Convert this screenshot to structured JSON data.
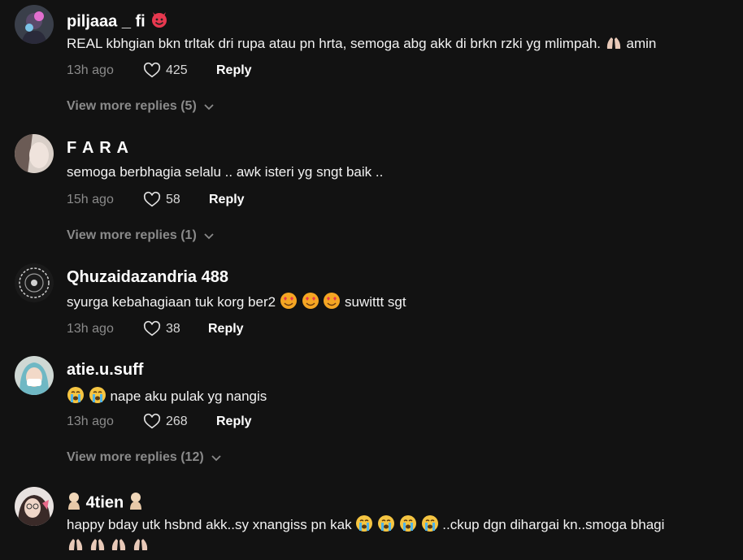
{
  "comments": [
    {
      "username": "piljaaa _ fi",
      "text": "REAL kbhgian bkn trltak dri rupa atau pn hrta, semoga abg akk di brkn rzki yg mlimpah.",
      "text_suffix": "amin",
      "time": "13h ago",
      "likes": "425",
      "reply_label": "Reply",
      "view_more": "View more replies (5)"
    },
    {
      "username": "F A R A",
      "text": "semoga berbhagia selalu .. awk isteri yg sngt baik ..",
      "time": "15h ago",
      "likes": "58",
      "reply_label": "Reply",
      "view_more": "View more replies (1)"
    },
    {
      "username": "Qhuzaidazandria 488",
      "text": "syurga kebahagiaan tuk korg ber2",
      "text_suffix": "suwittt sgt",
      "time": "13h ago",
      "likes": "38",
      "reply_label": "Reply"
    },
    {
      "username": "atie.u.suff",
      "text": "nape aku pulak yg nangis",
      "time": "13h ago",
      "likes": "268",
      "reply_label": "Reply",
      "view_more": "View more replies (12)"
    },
    {
      "username": "4tien",
      "text": "happy bday utk hsbnd akk..sy xnangiss pn kak",
      "text_suffix": "..ckup dgn dihargai kn..smoga bhagi"
    }
  ],
  "colors": {
    "background": "#121212",
    "muted": "#8a8a8a",
    "text": "#ffffff",
    "devil": "#e8384f"
  },
  "icons": [
    "heart-outline-icon",
    "chevron-down-icon",
    "smiling-face-with-horns-emoji",
    "folded-hands-emoji",
    "smiling-face-with-heart-eyes-emoji",
    "crying-face-emoji",
    "person-emoji"
  ]
}
